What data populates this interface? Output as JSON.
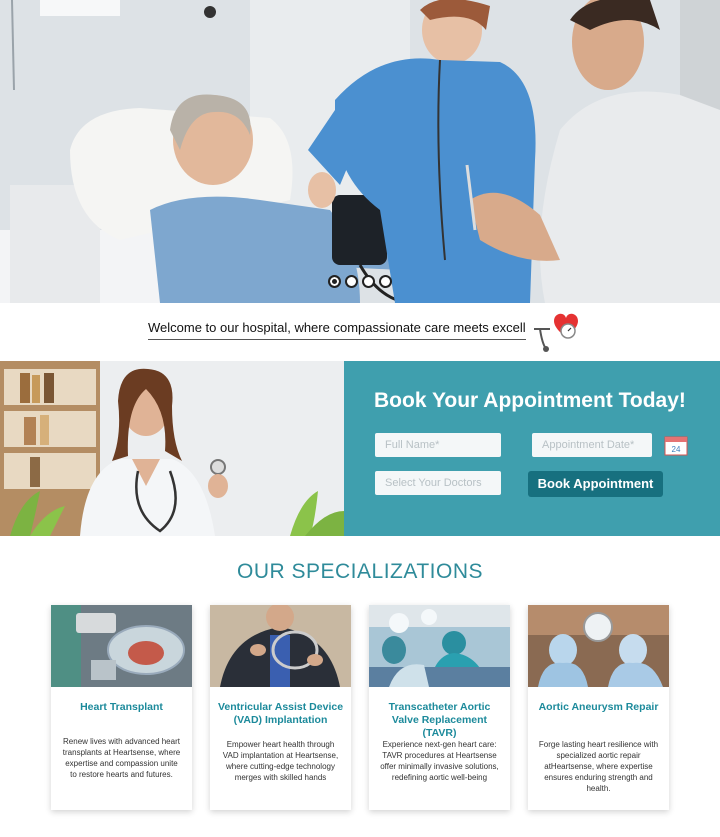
{
  "hero": {
    "carousel_dots": 4,
    "active_dot": 0
  },
  "welcome": {
    "text": "Welcome to our hospital, where compassionate care meets excellence"
  },
  "booking": {
    "title": "Book Your Appointment Today!",
    "full_name_placeholder": "Full Name*",
    "date_placeholder": "Appointment Date*",
    "calendar_day": "24",
    "doctor_placeholder": "Select Your Doctors",
    "button_label": "Book Appointment"
  },
  "specializations": {
    "title": "OUR SPECIALIZATIONS",
    "cards": [
      {
        "title": "Heart Transplant",
        "description": "Renew lives with advanced heart transplants at Heartsense, where expertise and compassion unite to restore hearts and futures."
      },
      {
        "title": "Ventricular Assist Device (VAD) Implantation",
        "description": "Empower heart health through VAD implantation at Heartsense, where cutting-edge technology merges with skilled hands"
      },
      {
        "title": "Transcatheter Aortic Valve Replacement (TAVR)",
        "description": "Experience next-gen heart care: TAVR procedures at Heartsense offer minimally invasive solutions, redefining aortic well-being"
      },
      {
        "title": "Aortic Aneurysm Repair",
        "description": "Forge lasting heart resilience with specialized aortic repair atHeartsense, where expertise ensures enduring strength and health."
      }
    ]
  },
  "colors": {
    "teal_panel": "#3f9fae",
    "button": "#17707f",
    "heading": "#2f8b9a",
    "card_title": "#1c8a9b"
  }
}
